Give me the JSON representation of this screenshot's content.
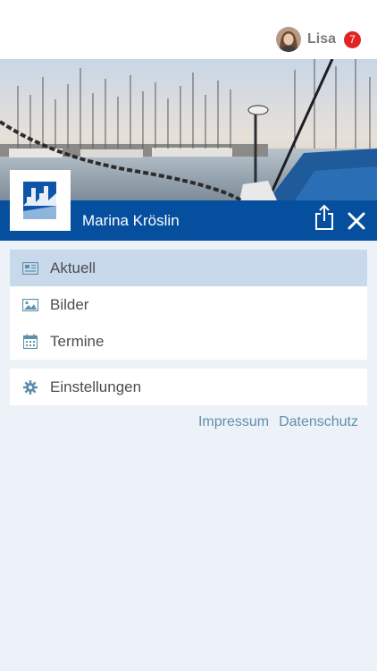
{
  "header": {
    "user_name": "Lisa",
    "notification_count": "7"
  },
  "club": {
    "title": "Marina Kröslin"
  },
  "menu": {
    "items": [
      {
        "label": "Aktuell",
        "icon": "newspaper-icon",
        "active": true
      },
      {
        "label": "Bilder",
        "icon": "image-icon",
        "active": false
      },
      {
        "label": "Termine",
        "icon": "calendar-icon",
        "active": false
      }
    ],
    "settings": {
      "label": "Einstellungen",
      "icon": "gear-icon"
    }
  },
  "footer_links": {
    "impressum": "Impressum",
    "datenschutz": "Datenschutz"
  },
  "colors": {
    "primary": "#064f9f",
    "active_item": "#c8d9ec",
    "background": "#edf2f9",
    "badge": "#e02424",
    "link": "#5e90ad"
  }
}
